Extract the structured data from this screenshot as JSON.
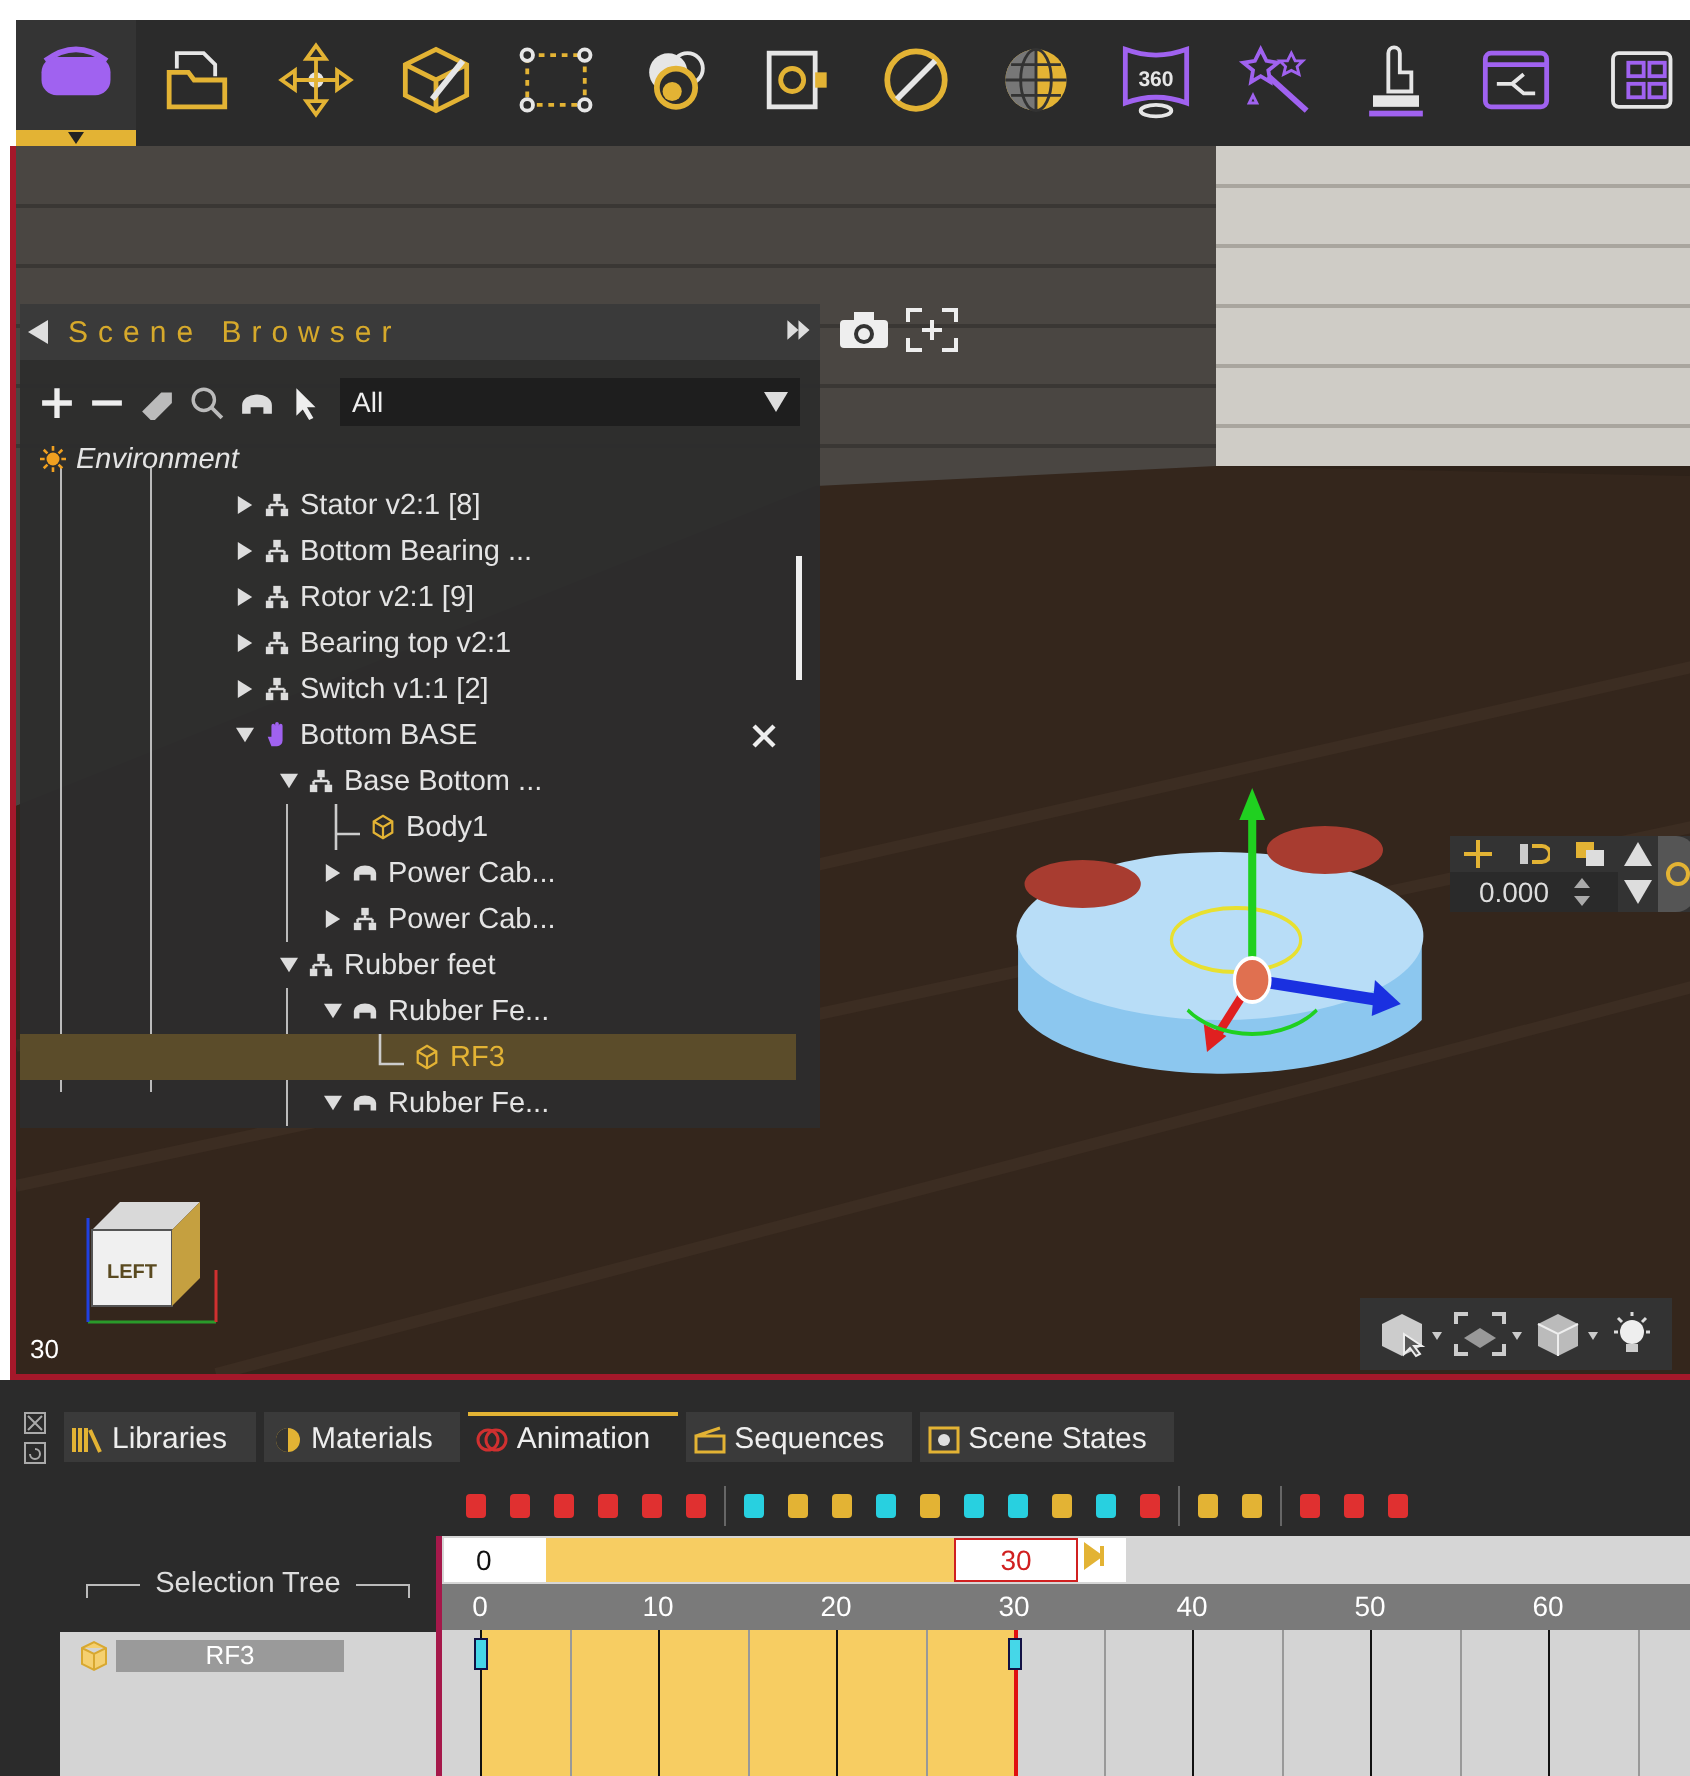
{
  "toolbar": [
    {
      "selected": true
    },
    {
      "selected": false
    },
    {
      "selected": false
    },
    {
      "selected": false
    },
    {
      "selected": false
    },
    {
      "selected": false
    },
    {
      "selected": false
    },
    {
      "selected": false
    },
    {
      "selected": false
    },
    {
      "selected": false,
      "badge": "360"
    },
    {
      "selected": false
    },
    {
      "selected": false
    },
    {
      "selected": false
    },
    {
      "selected": false
    }
  ],
  "scene_browser": {
    "title": "Scene Browser",
    "filter": "All",
    "tree": [
      {
        "label": "Environment",
        "kind": "environment",
        "selected": false,
        "children": [
          {
            "label": "Stator v2:1  [8]",
            "kind": "assembly",
            "expanded": false,
            "selected": false
          },
          {
            "label": "Bottom Bearing ...",
            "kind": "assembly",
            "expanded": false,
            "selected": false
          },
          {
            "label": "Rotor v2:1 [9]",
            "kind": "assembly",
            "expanded": false,
            "selected": false
          },
          {
            "label": "Bearing top v2:1",
            "kind": "assembly",
            "expanded": false,
            "selected": false
          },
          {
            "label": "Switch v1:1 [2]",
            "kind": "assembly",
            "expanded": false,
            "selected": false
          },
          {
            "label": "Bottom BASE",
            "kind": "hand",
            "expanded": true,
            "selected": false,
            "closable": true,
            "children": [
              {
                "label": "Base Bottom ...",
                "kind": "assembly",
                "expanded": true,
                "selected": false,
                "children": [
                  {
                    "label": "Body1",
                    "kind": "body",
                    "selected": false
                  },
                  {
                    "label": "Power Cab...",
                    "kind": "part",
                    "expanded": false,
                    "selected": false
                  },
                  {
                    "label": "Power Cab...",
                    "kind": "assembly",
                    "expanded": false,
                    "selected": false
                  }
                ]
              },
              {
                "label": "Rubber feet",
                "kind": "assembly",
                "expanded": true,
                "selected": false,
                "children": [
                  {
                    "label": "Rubber Fe...",
                    "kind": "part",
                    "expanded": true,
                    "selected": false,
                    "children": [
                      {
                        "label": "RF3",
                        "kind": "body",
                        "selected": true
                      }
                    ]
                  },
                  {
                    "label": "Rubber Fe...",
                    "kind": "part",
                    "expanded": true,
                    "selected": false
                  }
                ]
              }
            ]
          }
        ]
      }
    ]
  },
  "gizmo": {
    "value": "0.000"
  },
  "viewport": {
    "nav_cube_face": "LEFT",
    "frame_label": "30"
  },
  "bottom_tabs": [
    {
      "label": "Libraries",
      "selected": false
    },
    {
      "label": "Materials",
      "selected": false
    },
    {
      "label": "Animation",
      "selected": true
    },
    {
      "label": "Sequences",
      "selected": false
    },
    {
      "label": "Scene States",
      "selected": false
    }
  ],
  "timeline": {
    "tree_title": "Selection Tree",
    "range_start": "0",
    "range_end": "30",
    "ruler": [
      "0",
      "10",
      "20",
      "30",
      "40",
      "50",
      "60"
    ],
    "tracks": [
      {
        "label": "RF3"
      }
    ]
  }
}
